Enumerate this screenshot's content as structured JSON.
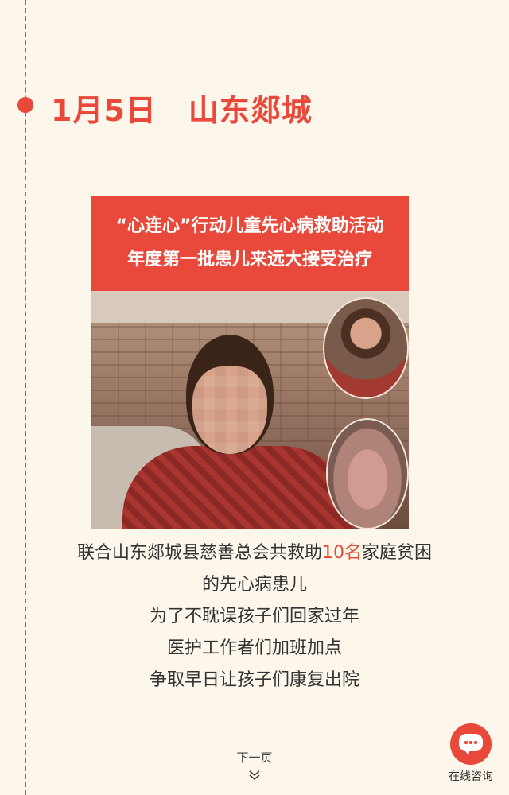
{
  "header": {
    "date": "1月5日",
    "location": "山东郯城"
  },
  "banner": {
    "line1": "“心连心”行动儿童先心病救助活动",
    "line2": "年度第一批患儿来远大接受治疗"
  },
  "body": {
    "line1_prefix": "联合山东郯城县慈善总会共救助",
    "line1_highlight": "10名",
    "line1_suffix": "家庭贫困",
    "line2": "的先心病患儿",
    "line3": "为了不耽误孩子们回家过年",
    "line4": "医护工作者们加班加点",
    "line5": "争取早日让孩子们康复出院"
  },
  "nav": {
    "next_label": "下一页",
    "next_icon": "double-chevron-down-icon"
  },
  "consult": {
    "label": "在线咨询",
    "icon": "chat-bubble-icon"
  },
  "colors": {
    "accent": "#e8493a",
    "background": "#fdf6ea"
  }
}
